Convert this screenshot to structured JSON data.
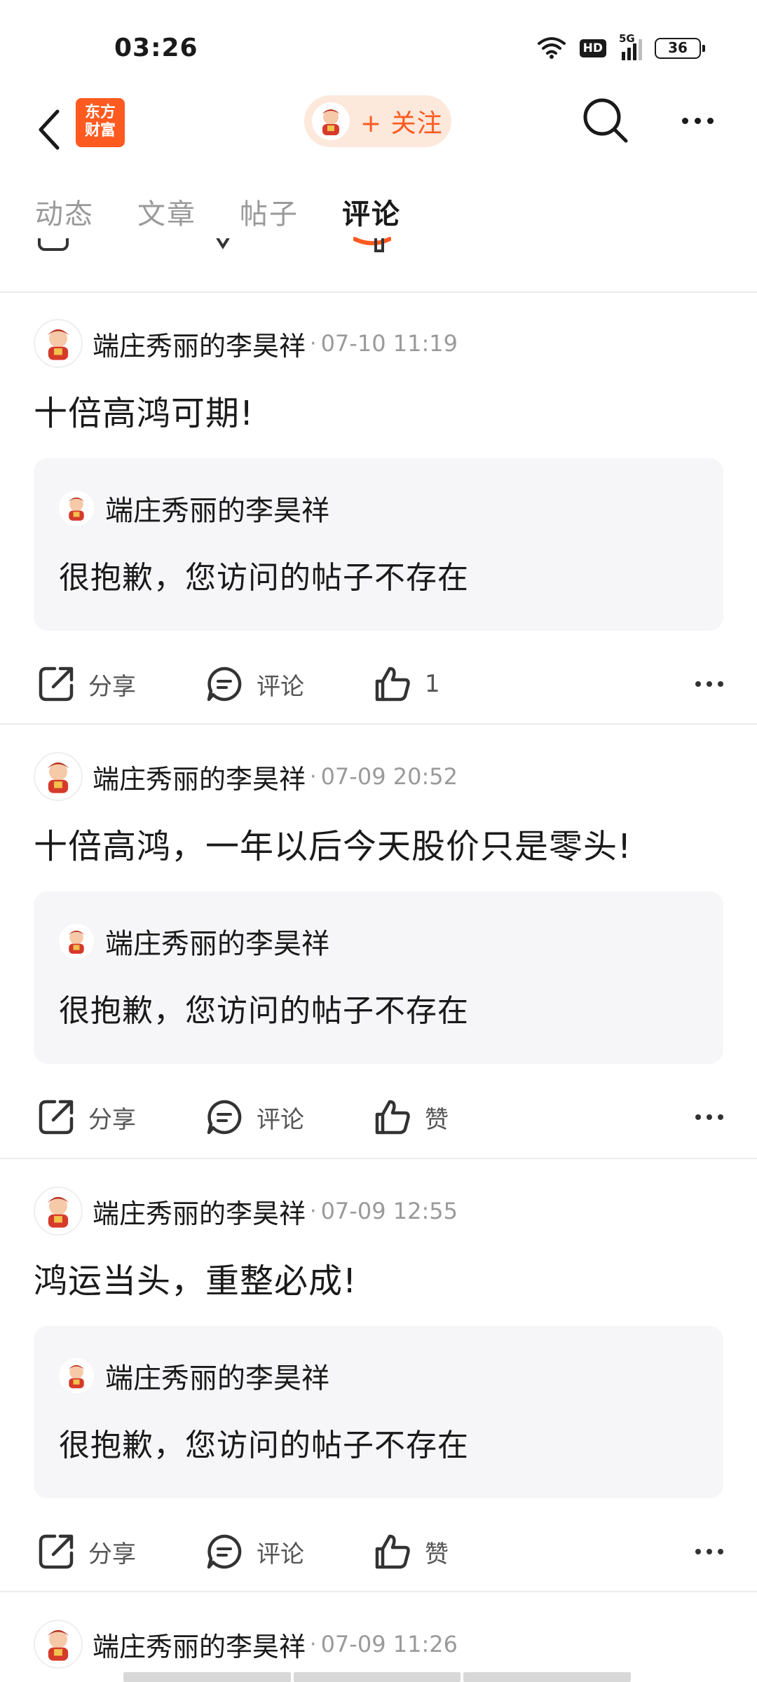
{
  "status": {
    "time": "03:26",
    "network": "5G",
    "hd": "HD",
    "battery": "36"
  },
  "header": {
    "logo_text": [
      "东方",
      "财富"
    ],
    "follow_label": "+ 关注"
  },
  "tabs": [
    {
      "label": "动态",
      "active": false
    },
    {
      "label": "文章",
      "active": false
    },
    {
      "label": "帖子",
      "active": false
    },
    {
      "label": "评论",
      "active": true
    }
  ],
  "colors": {
    "accent": "#ff5a1f",
    "follow_bg": "#fde8dc",
    "quote_bg": "#f6f6f8",
    "muted": "#9a9a9a"
  },
  "posts": [
    {
      "author": "端庄秀丽的李昊祥",
      "time": "07-10 11:19",
      "body": "十倍高鸿可期!",
      "quote": {
        "author": "端庄秀丽的李昊祥",
        "text": "很抱歉，您访问的帖子不存在"
      },
      "actions": {
        "share": "分享",
        "comment": "评论",
        "like": "1"
      }
    },
    {
      "author": "端庄秀丽的李昊祥",
      "time": "07-09 20:52",
      "body": "十倍高鸿，一年以后今天股价只是零头!",
      "quote": {
        "author": "端庄秀丽的李昊祥",
        "text": "很抱歉，您访问的帖子不存在"
      },
      "actions": {
        "share": "分享",
        "comment": "评论",
        "like": "赞"
      }
    },
    {
      "author": "端庄秀丽的李昊祥",
      "time": "07-09 12:55",
      "body": "鸿运当头，重整必成!",
      "quote": {
        "author": "端庄秀丽的李昊祥",
        "text": "很抱歉，您访问的帖子不存在"
      },
      "actions": {
        "share": "分享",
        "comment": "评论",
        "like": "赞"
      }
    },
    {
      "author": "端庄秀丽的李昊祥",
      "time": "07-09 11:26"
    }
  ],
  "separator": "·"
}
